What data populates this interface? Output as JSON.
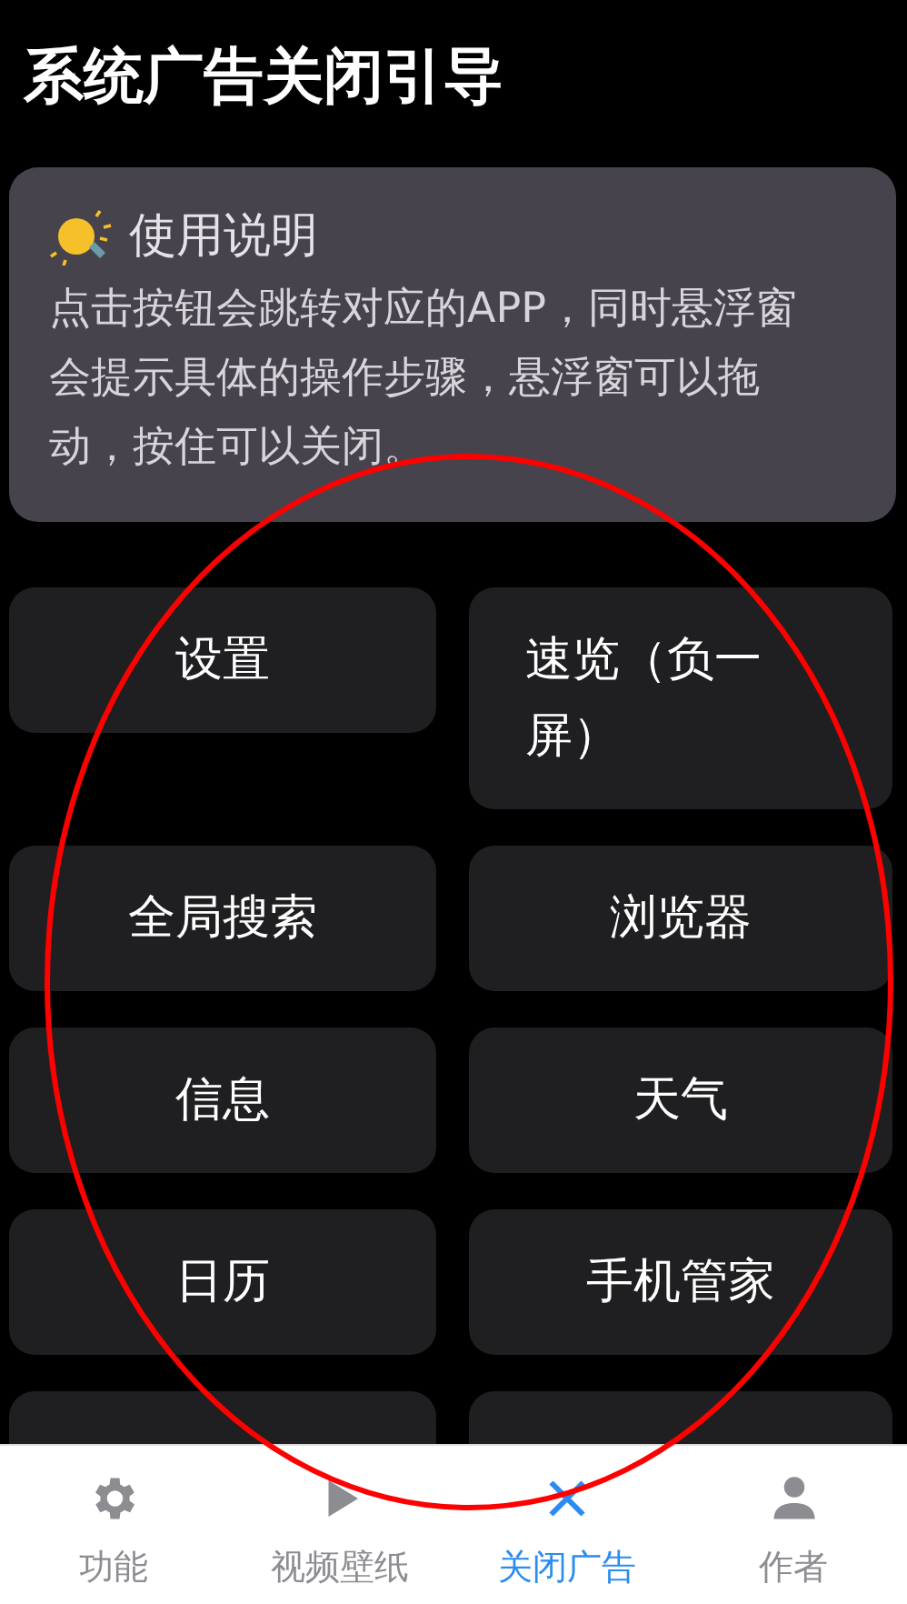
{
  "title": "系统广告关闭引导",
  "notice": {
    "heading": "使用说明",
    "body": "点击按钮会跳转对应的APP，同时悬浮窗会提示具体的操作步骤，悬浮窗可以拖动，按住可以关闭。"
  },
  "buttons": [
    {
      "label": "设置"
    },
    {
      "label": "速览（负一屏）"
    },
    {
      "label": "全局搜索"
    },
    {
      "label": "浏览器"
    },
    {
      "label": "信息"
    },
    {
      "label": "天气"
    },
    {
      "label": "日历"
    },
    {
      "label": "手机管家"
    }
  ],
  "tab_bar": [
    {
      "label": "功能",
      "kind": "gear",
      "selected": false
    },
    {
      "label": "视频壁纸",
      "kind": "play",
      "selected": false
    },
    {
      "label": "关闭广告",
      "kind": "close",
      "selected": true
    },
    {
      "label": "作者",
      "kind": "person",
      "selected": false
    }
  ]
}
